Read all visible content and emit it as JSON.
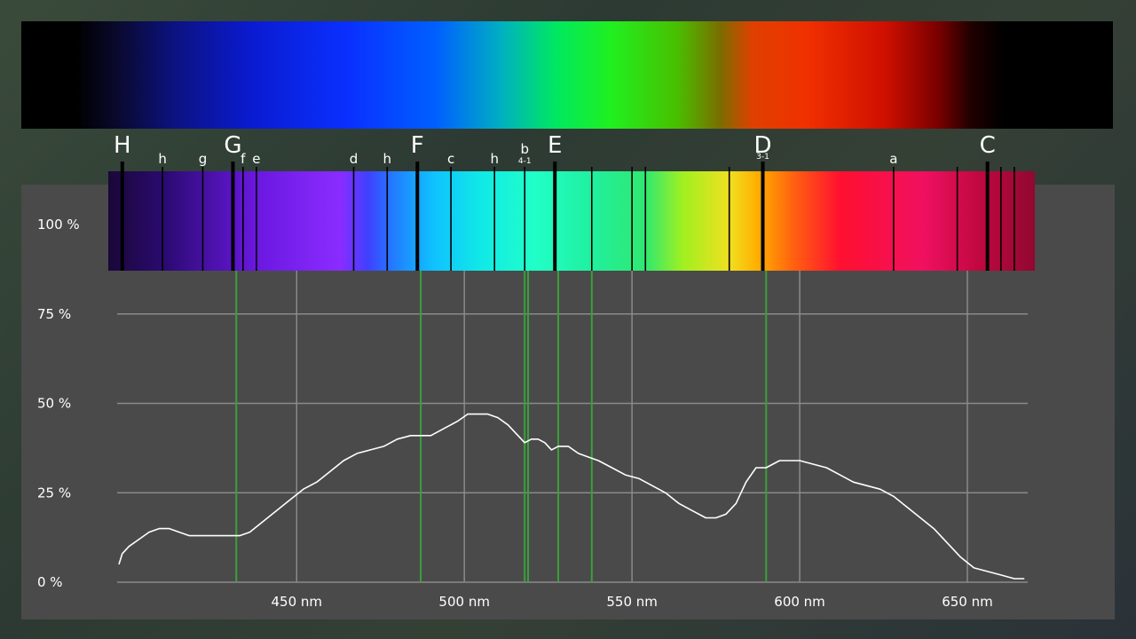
{
  "chart_data": {
    "type": "line",
    "title": "",
    "xlabel": "",
    "ylabel": "",
    "xlim": [
      397,
      668
    ],
    "ylim": [
      0,
      100
    ],
    "x_ticks": [
      {
        "value": 450,
        "label": "450 nm"
      },
      {
        "value": 500,
        "label": "500 nm"
      },
      {
        "value": 550,
        "label": "550 nm"
      },
      {
        "value": 600,
        "label": "600 nm"
      },
      {
        "value": 650,
        "label": "650 nm"
      }
    ],
    "y_ticks": [
      {
        "value": 0,
        "label": "0 %"
      },
      {
        "value": 25,
        "label": "25 %"
      },
      {
        "value": 50,
        "label": "50 %"
      },
      {
        "value": 75,
        "label": "75 %"
      },
      {
        "value": 100,
        "label": "100 %"
      }
    ],
    "grid": true,
    "series": [
      {
        "x": [
          397,
          398,
          400,
          403,
          406,
          409,
          412,
          415,
          418,
          421,
          424,
          427,
          430,
          433,
          436,
          440,
          444,
          448,
          452,
          456,
          460,
          464,
          468,
          472,
          476,
          480,
          484,
          487,
          490,
          494,
          498,
          501,
          504,
          507,
          510,
          513,
          516,
          518,
          520,
          522,
          524,
          526,
          528,
          531,
          534,
          537,
          540,
          544,
          548,
          552,
          556,
          560,
          564,
          568,
          572,
          575,
          578,
          581,
          584,
          587,
          590,
          592,
          594,
          597,
          600,
          604,
          608,
          612,
          616,
          620,
          624,
          628,
          632,
          636,
          640,
          644,
          648,
          652,
          656,
          660,
          664,
          667
        ],
        "y": [
          5,
          8,
          10,
          12,
          14,
          15,
          15,
          14,
          13,
          13,
          13,
          13,
          13,
          13,
          14,
          17,
          20,
          23,
          26,
          28,
          31,
          34,
          36,
          37,
          38,
          40,
          41,
          41,
          41,
          43,
          45,
          47,
          47,
          47,
          46,
          44,
          41,
          39,
          40,
          40,
          39,
          37,
          38,
          38,
          36,
          35,
          34,
          32,
          30,
          29,
          27,
          25,
          22,
          20,
          18,
          18,
          19,
          22,
          28,
          32,
          32,
          33,
          34,
          34,
          34,
          33,
          32,
          30,
          28,
          27,
          26,
          24,
          21,
          18,
          15,
          11,
          7,
          4,
          3,
          2,
          1,
          1
        ]
      }
    ],
    "vertical_markers_nm": [
      432,
      487,
      518,
      519,
      528,
      538,
      590
    ],
    "band_lines": [
      {
        "label": "H",
        "big": true,
        "nm": 398
      },
      {
        "label": "h",
        "big": false,
        "nm": 410
      },
      {
        "label": "g",
        "big": false,
        "nm": 422
      },
      {
        "label": "G",
        "big": true,
        "nm": 431
      },
      {
        "label": "f",
        "big": false,
        "nm": 434
      },
      {
        "label": "e",
        "big": false,
        "nm": 438
      },
      {
        "label": "d",
        "big": false,
        "nm": 467
      },
      {
        "label": "h",
        "big": false,
        "nm": 477
      },
      {
        "label": "F",
        "big": true,
        "nm": 486
      },
      {
        "label": "c",
        "big": false,
        "nm": 496
      },
      {
        "label": "h",
        "big": false,
        "nm": 509
      },
      {
        "label": "b",
        "sub": "4-1",
        "big": false,
        "nm": 518
      },
      {
        "label": "E",
        "big": true,
        "nm": 527
      },
      {
        "label": "D",
        "sub": "3-1",
        "big": true,
        "nm": 589
      },
      {
        "label": "a",
        "big": false,
        "nm": 628
      },
      {
        "label": "C",
        "big": true,
        "nm": 656
      }
    ],
    "extra_band_lines_nm": [
      538,
      550,
      554,
      579,
      647,
      660,
      664
    ]
  }
}
